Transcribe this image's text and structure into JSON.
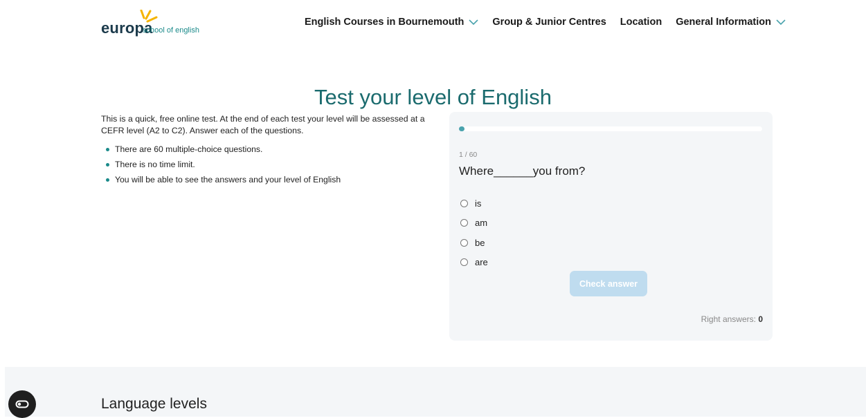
{
  "logo": {
    "word": "europa",
    "sub": "school of english"
  },
  "nav": [
    {
      "label": "English Courses in Bournemouth",
      "dropdown": true
    },
    {
      "label": "Group & Junior Centres",
      "dropdown": false
    },
    {
      "label": "Location",
      "dropdown": false
    },
    {
      "label": "General Information",
      "dropdown": true
    }
  ],
  "page": {
    "title": "Test your level of English"
  },
  "intro": {
    "text": "This is a quick, free online test. At the end of each test your level will be assessed at a CEFR level (A2 to C2). Answer each of the questions.",
    "bullets": [
      "There are 60 multiple-choice questions.",
      "There is no time limit.",
      "You will be able to see the answers and your level of English"
    ]
  },
  "quiz": {
    "progress_fraction": 0.0167,
    "counter": "1 / 60",
    "question": "Where______you from?",
    "options": [
      "is",
      "am",
      "be",
      "are"
    ],
    "check_label": "Check answer",
    "right_answers_label": "Right answers:",
    "right_answers_value": "0"
  },
  "levels": {
    "title": "Language levels"
  },
  "colors": {
    "accent": "#1b6b6e",
    "progress": "#4aa3ad",
    "button": "#bfdcef",
    "logo_ray": "#f5b400"
  },
  "icons": [
    "chevron-down-icon",
    "radio-icon",
    "cookie-settings-icon",
    "logo-rays-icon"
  ]
}
